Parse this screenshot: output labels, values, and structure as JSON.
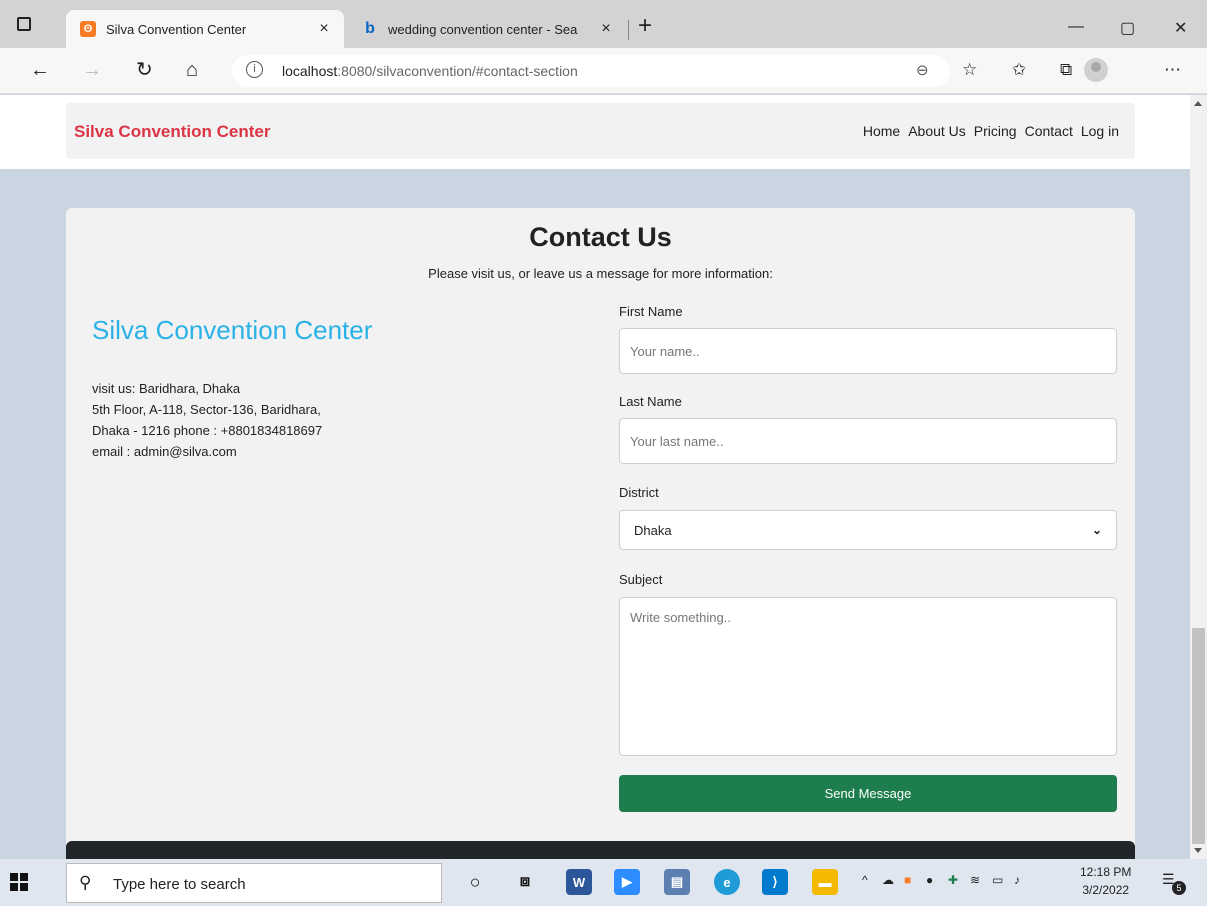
{
  "browser": {
    "tabs": [
      {
        "title": "Silva Convention Center",
        "close": "×"
      },
      {
        "title": "wedding convention center - Sea",
        "close": "×"
      }
    ],
    "new_tab": "+",
    "url_host": "localhost",
    "url_rest": ":8080/silvaconvention/#contact-section",
    "window_controls": [
      "—",
      "▢",
      "✕"
    ]
  },
  "navbar": {
    "brand": "Silva Convention Center",
    "links": [
      "Home",
      "About Us",
      "Pricing",
      "Contact",
      "Log in"
    ]
  },
  "contact": {
    "title": "Contact Us",
    "subtitle": "Please visit us, or leave us a message for more information:",
    "center_name": "Silva Convention Center",
    "address_lines": [
      "visit us: Baridhara, Dhaka",
      "5th Floor, A-118, Sector-136, Baridhara,",
      "Dhaka - 1216 phone : +8801834818697",
      "email : admin@silva.com"
    ]
  },
  "form": {
    "first_name_label": "First Name",
    "first_name_placeholder": "Your name..",
    "last_name_label": "Last Name",
    "last_name_placeholder": "Your last name..",
    "district_label": "District",
    "district_value": "Dhaka",
    "subject_label": "Subject",
    "subject_placeholder": "Write something..",
    "submit_label": "Send Message"
  },
  "taskbar": {
    "search_placeholder": "Type here to search",
    "time": "12:18 PM",
    "date": "3/2/2022",
    "notification_count": "5"
  },
  "colors": {
    "brand_red": "#dc3545",
    "center_blue": "#2ab2e8",
    "send_green": "#1e7d4c",
    "page_bg": "#c9d5e1"
  }
}
